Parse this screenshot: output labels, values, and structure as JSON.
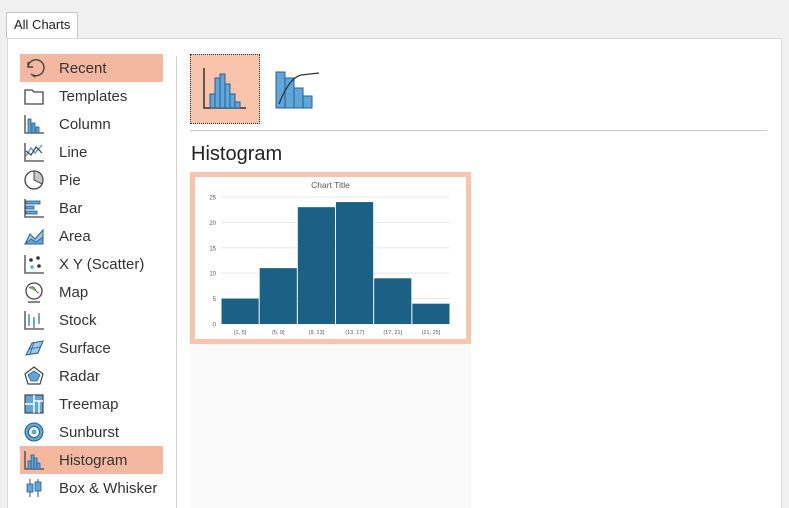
{
  "tab": {
    "label": "All Charts"
  },
  "sidebar": {
    "items": [
      {
        "label": "Recent",
        "icon": "recent-icon",
        "selected": true
      },
      {
        "label": "Templates",
        "icon": "templates-icon"
      },
      {
        "label": "Column",
        "icon": "column-chart-icon"
      },
      {
        "label": "Line",
        "icon": "line-chart-icon"
      },
      {
        "label": "Pie",
        "icon": "pie-chart-icon"
      },
      {
        "label": "Bar",
        "icon": "bar-chart-icon"
      },
      {
        "label": "Area",
        "icon": "area-chart-icon"
      },
      {
        "label": "X Y (Scatter)",
        "icon": "scatter-chart-icon"
      },
      {
        "label": "Map",
        "icon": "map-chart-icon"
      },
      {
        "label": "Stock",
        "icon": "stock-chart-icon"
      },
      {
        "label": "Surface",
        "icon": "surface-chart-icon"
      },
      {
        "label": "Radar",
        "icon": "radar-chart-icon"
      },
      {
        "label": "Treemap",
        "icon": "treemap-chart-icon"
      },
      {
        "label": "Sunburst",
        "icon": "sunburst-chart-icon"
      },
      {
        "label": "Histogram",
        "icon": "histogram-chart-icon",
        "selected": true
      },
      {
        "label": "Box & Whisker",
        "icon": "box-whisker-chart-icon"
      }
    ]
  },
  "subtypes": [
    {
      "icon": "histogram-subtype-icon",
      "selected": true
    },
    {
      "icon": "pareto-subtype-icon",
      "selected": false
    }
  ],
  "heading": "Histogram",
  "colors": {
    "accent": "#f4b8a0",
    "bar": "#1b6185",
    "icon_blue": "#5ea6dc"
  },
  "chart_data": {
    "type": "bar",
    "title": "Chart Title",
    "categories": [
      "[1, 5]",
      "(5, 9]",
      "(9, 13]",
      "(13, 17]",
      "(17, 21]",
      "(21, 25]"
    ],
    "values": [
      5,
      11,
      23,
      24,
      9,
      4
    ],
    "ylim": [
      0,
      25
    ],
    "yticks": [
      0,
      5,
      10,
      15,
      20,
      25
    ],
    "grid": true,
    "xlabel": "",
    "ylabel": ""
  }
}
